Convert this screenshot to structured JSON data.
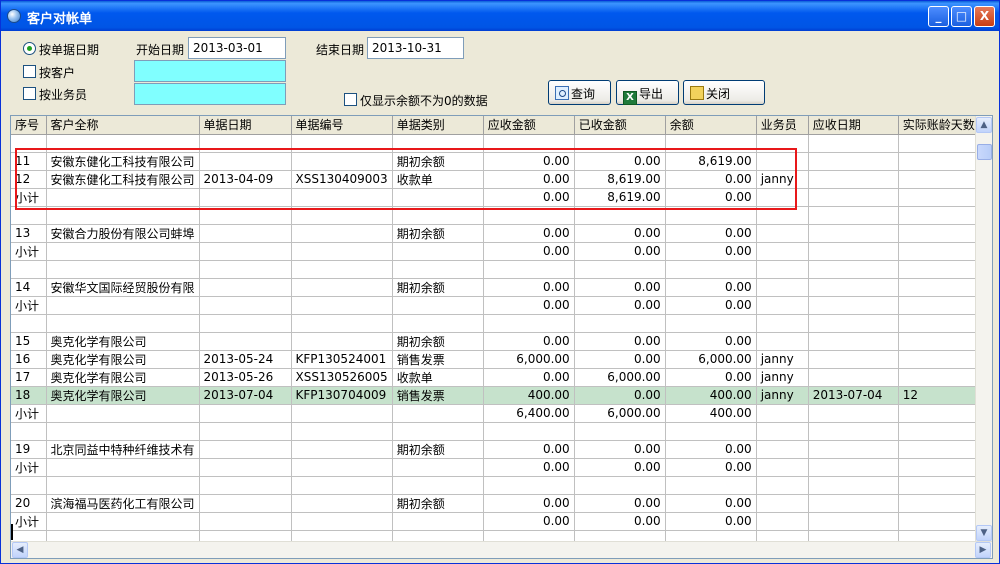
{
  "window": {
    "title": "客户对帐单",
    "controls": {
      "minimize": "_",
      "maximize": "□",
      "close": "X"
    }
  },
  "filters": {
    "by_doc_date": "按单据日期",
    "by_customer": "按客户",
    "by_salesman": "按业务员",
    "start_date_label": "开始日期",
    "start_date": "2013-03-01",
    "end_date_label": "结束日期",
    "end_date": "2013-10-31",
    "customer_value": "",
    "salesman_value": "",
    "nonzero_only": "仅显示余额不为0的数据"
  },
  "buttons": {
    "query": "查询",
    "export": "导出",
    "close": "关闭"
  },
  "table": {
    "columns": [
      "序号",
      "客户全称",
      "单据日期",
      "单据编号",
      "单据类别",
      "应收金额",
      "已收金额",
      "余额",
      "业务员",
      "应收日期",
      "实际账龄天数"
    ],
    "rows": [
      [
        "",
        "",
        "",
        "",
        "",
        "",
        "",
        "",
        "",
        "",
        ""
      ],
      [
        "11",
        "安徽东健化工科技有限公司",
        "",
        "",
        "期初余额",
        "0.00",
        "0.00",
        "8,619.00",
        "",
        "",
        ""
      ],
      [
        "12",
        "安徽东健化工科技有限公司",
        "2013-04-09",
        "XSS130409003",
        "收款单",
        "0.00",
        "8,619.00",
        "0.00",
        "janny",
        "",
        ""
      ],
      [
        "小计",
        "",
        "",
        "",
        "",
        "0.00",
        "8,619.00",
        "0.00",
        "",
        "",
        ""
      ],
      [
        "",
        "",
        "",
        "",
        "",
        "",
        "",
        "",
        "",
        "",
        ""
      ],
      [
        "13",
        "安徽合力股份有限公司蚌埠",
        "",
        "",
        "期初余额",
        "0.00",
        "0.00",
        "0.00",
        "",
        "",
        ""
      ],
      [
        "小计",
        "",
        "",
        "",
        "",
        "0.00",
        "0.00",
        "0.00",
        "",
        "",
        ""
      ],
      [
        "",
        "",
        "",
        "",
        "",
        "",
        "",
        "",
        "",
        "",
        ""
      ],
      [
        "14",
        "安徽华文国际经贸股份有限",
        "",
        "",
        "期初余额",
        "0.00",
        "0.00",
        "0.00",
        "",
        "",
        ""
      ],
      [
        "小计",
        "",
        "",
        "",
        "",
        "0.00",
        "0.00",
        "0.00",
        "",
        "",
        ""
      ],
      [
        "",
        "",
        "",
        "",
        "",
        "",
        "",
        "",
        "",
        "",
        ""
      ],
      [
        "15",
        "奥克化学有限公司",
        "",
        "",
        "期初余额",
        "0.00",
        "0.00",
        "0.00",
        "",
        "",
        ""
      ],
      [
        "16",
        "奥克化学有限公司",
        "2013-05-24",
        "KFP130524001",
        "销售发票",
        "6,000.00",
        "0.00",
        "6,000.00",
        "janny",
        "",
        ""
      ],
      [
        "17",
        "奥克化学有限公司",
        "2013-05-26",
        "XSS130526005",
        "收款单",
        "0.00",
        "6,000.00",
        "0.00",
        "janny",
        "",
        ""
      ],
      [
        "18",
        "奥克化学有限公司",
        "2013-07-04",
        "KFP130704009",
        "销售发票",
        "400.00",
        "0.00",
        "400.00",
        "janny",
        "2013-07-04",
        "12"
      ],
      [
        "小计",
        "",
        "",
        "",
        "",
        "6,400.00",
        "6,000.00",
        "400.00",
        "",
        "",
        ""
      ],
      [
        "",
        "",
        "",
        "",
        "",
        "",
        "",
        "",
        "",
        "",
        ""
      ],
      [
        "19",
        "北京同益中特种纤维技术有",
        "",
        "",
        "期初余额",
        "0.00",
        "0.00",
        "0.00",
        "",
        "",
        ""
      ],
      [
        "小计",
        "",
        "",
        "",
        "",
        "0.00",
        "0.00",
        "0.00",
        "",
        "",
        ""
      ],
      [
        "",
        "",
        "",
        "",
        "",
        "",
        "",
        "",
        "",
        "",
        ""
      ],
      [
        "20",
        "滨海福马医药化工有限公司",
        "",
        "",
        "期初余额",
        "0.00",
        "0.00",
        "0.00",
        "",
        "",
        ""
      ],
      [
        "小计",
        "",
        "",
        "",
        "",
        "0.00",
        "0.00",
        "0.00",
        "",
        "",
        ""
      ],
      [
        "",
        "",
        "",
        "",
        "",
        "",
        "",
        "",
        "",
        "",
        ""
      ]
    ],
    "selected_row_no": "18"
  },
  "icons": {
    "app": "app-globe-icon",
    "query": "magnifier-icon",
    "export": "excel-icon",
    "close": "exit-door-icon"
  }
}
